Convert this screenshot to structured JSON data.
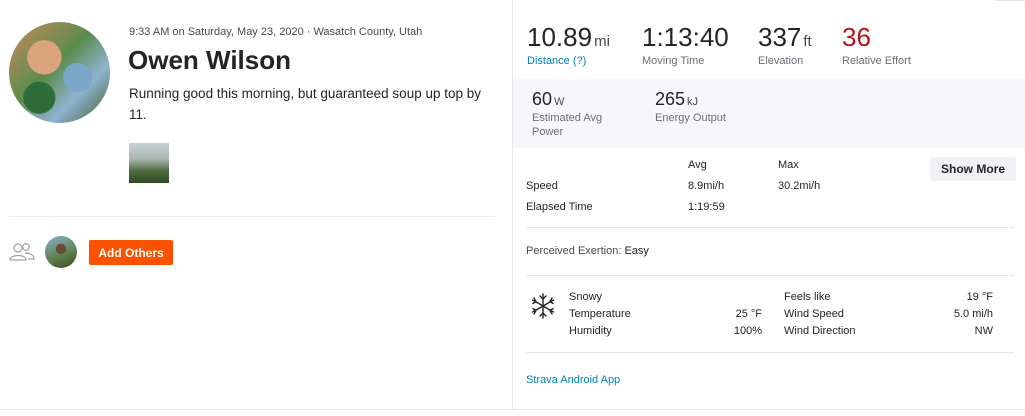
{
  "activity": {
    "meta": "9:33 AM on Saturday, May 23, 2020 · Wasatch County, Utah",
    "athlete_name": "Owen Wilson",
    "description": "Running good this morning, but guaranteed soup up top by 11.",
    "add_others_label": "Add Others"
  },
  "stats": {
    "distance": {
      "value": "10.89",
      "unit": "mi",
      "label": "Distance (?)"
    },
    "moving_time": {
      "value": "1:13:40",
      "label": "Moving Time"
    },
    "elevation": {
      "value": "337",
      "unit": "ft",
      "label": "Elevation"
    },
    "relative_effort": {
      "value": "36",
      "label": "Relative Effort"
    }
  },
  "secondary": {
    "power": {
      "value": "60",
      "unit": "W",
      "label": "Estimated Avg Power"
    },
    "energy": {
      "value": "265",
      "unit": "kJ",
      "label": "Energy Output"
    }
  },
  "table": {
    "col_avg": "Avg",
    "col_max": "Max",
    "rows": [
      {
        "label": "Speed",
        "avg": "8.9mi/h",
        "max": "30.2mi/h"
      },
      {
        "label": "Elapsed Time",
        "avg": "1:19:59",
        "max": ""
      }
    ],
    "show_more_label": "Show More"
  },
  "perceived": {
    "label": "Perceived Exertion:",
    "value": "Easy"
  },
  "weather": {
    "icon": "snowflake-icon",
    "condition": "Snowy",
    "temperature_label": "Temperature",
    "temperature_value": "25 °F",
    "humidity_label": "Humidity",
    "humidity_value": "100%",
    "feels_label": "Feels like",
    "feels_value": "19 °F",
    "wind_speed_label": "Wind Speed",
    "wind_speed_value": "5.0 mi/h",
    "wind_dir_label": "Wind Direction",
    "wind_dir_value": "NW"
  },
  "device": "Strava Android App",
  "colors": {
    "accent": "#fc5200",
    "link": "#007fb6",
    "effort": "#b9121b"
  }
}
